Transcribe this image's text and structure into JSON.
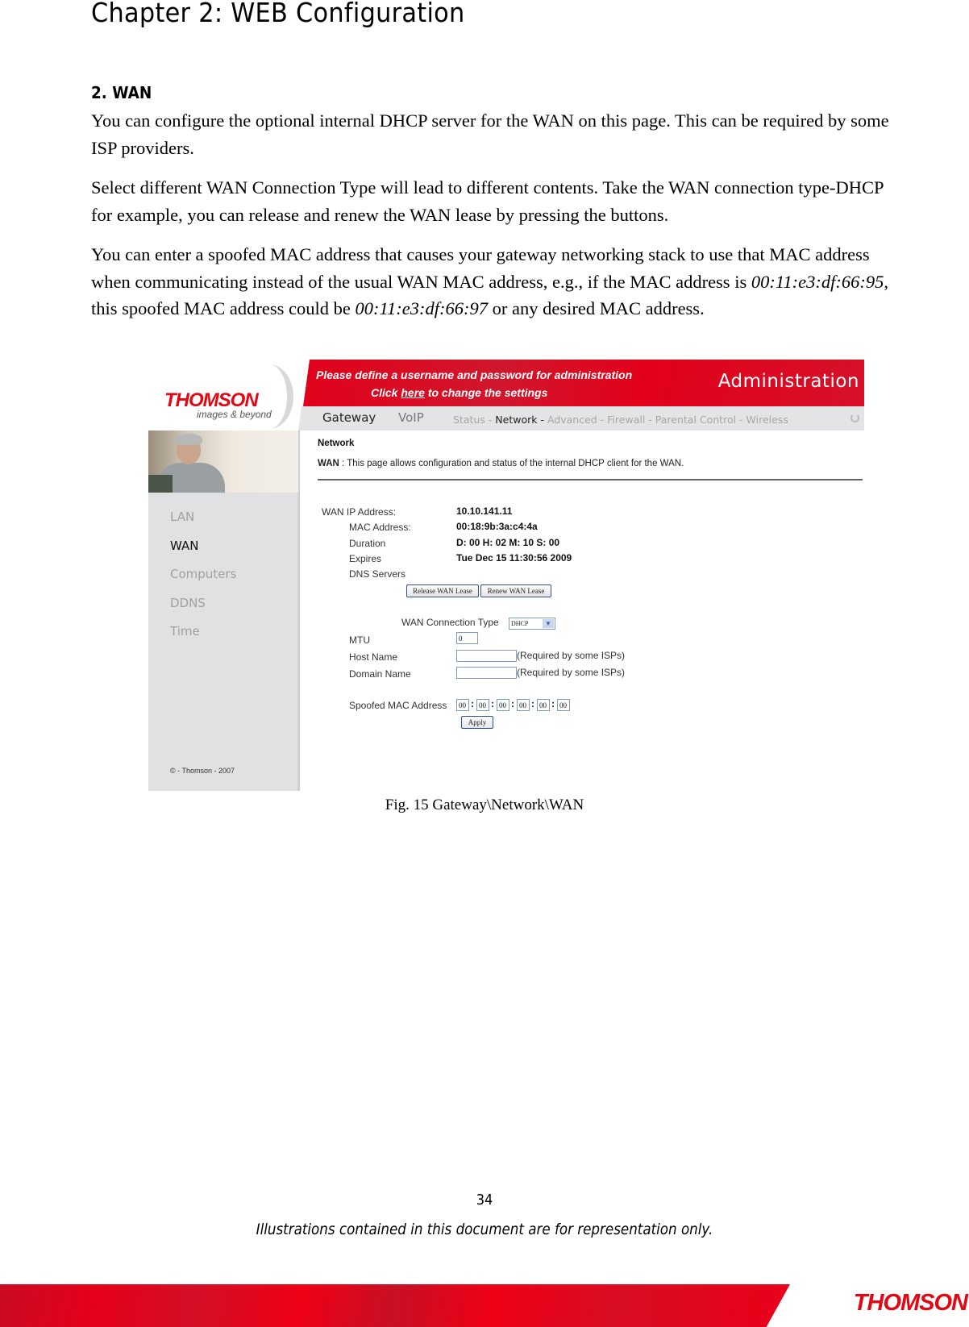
{
  "document": {
    "chapter_title": "Chapter 2: WEB Configuration",
    "section_heading": "2. WAN",
    "paragraphs": {
      "p1": "You can configure the optional internal DHCP server for the WAN on this page. This can be required by some ISP providers.",
      "p2": "Select different WAN Connection Type will lead to different contents. Take the WAN connection type-DHCP for example, you can release and renew the WAN lease by pressing the buttons.",
      "p3_part1": "You can enter a spoofed MAC address that causes your gateway networking stack to use that MAC address when communicating instead of the usual WAN MAC address, e.g., if the MAC address is ",
      "p3_mac1": "00:11:e3:df:66:95",
      "p3_part2": ", this spoofed MAC address could be ",
      "p3_mac2": "00:11:e3:df:66:97",
      "p3_part3": " or any desired MAC address."
    },
    "figure_caption": "Fig. 15 Gateway\\Network\\WAN",
    "page_number": "34",
    "disclaimer": "Illustrations contained in this document are for representation only.",
    "footer_logo": "THOMSON"
  },
  "screenshot": {
    "logo": {
      "brand": "THOMSON",
      "tagline": "images & beyond"
    },
    "banner": {
      "line1": "Please define a username and password for administration",
      "line2_prefix": "Click ",
      "line2_link": "here",
      "line2_suffix": " to change the settings",
      "section": "Administration"
    },
    "nav": {
      "main": [
        {
          "label": "Gateway",
          "active": true
        },
        {
          "label": "VoIP",
          "active": false
        }
      ],
      "sub": [
        {
          "label": "Status - ",
          "active": false
        },
        {
          "label": "Network - ",
          "active": true
        },
        {
          "label": "Advanced - ",
          "active": false
        },
        {
          "label": "Firewall - ",
          "active": false
        },
        {
          "label": "Parental Control - ",
          "active": false
        },
        {
          "label": "Wireless",
          "active": false
        }
      ],
      "refresh_icon": "refresh-icon"
    },
    "sidebar": {
      "items": [
        {
          "label": "LAN",
          "active": false
        },
        {
          "label": "WAN",
          "active": true
        },
        {
          "label": "Computers",
          "active": false
        },
        {
          "label": "DDNS",
          "active": false
        },
        {
          "label": "Time",
          "active": false
        }
      ],
      "copyright": "© - Thomson - 2007"
    },
    "content": {
      "title": "Network",
      "desc_label": "WAN",
      "desc_text": " :  This page allows configuration and status of the internal DHCP client for the WAN.",
      "status": {
        "wan_ip_label": "WAN IP Address:",
        "wan_ip_value": "10.10.141.11",
        "mac_label": "MAC Address:",
        "mac_value": "00:18:9b:3a:c4:4a",
        "duration_label": "Duration",
        "duration_value": "D: 00 H: 02 M: 10 S: 00",
        "expires_label": "Expires",
        "expires_value": "Tue Dec 15 11:30:56 2009",
        "dns_label": "DNS Servers",
        "dns_value": ""
      },
      "buttons": {
        "release": "Release WAN Lease",
        "renew": "Renew WAN Lease",
        "apply": "Apply"
      },
      "form": {
        "connection_type_label": "WAN Connection Type",
        "connection_type_value": "DHCP",
        "mtu_label": "MTU",
        "mtu_value": "0",
        "host_name_label": "Host Name",
        "host_name_value": "",
        "host_name_hint": "(Required by some ISPs)",
        "domain_name_label": "Domain Name",
        "domain_name_value": "",
        "domain_name_hint": "(Required by some ISPs)",
        "spoofed_mac_label": "Spoofed MAC Address",
        "spoofed_mac_octets": [
          "00",
          "00",
          "00",
          "00",
          "00",
          "00"
        ],
        "separator": ":"
      }
    }
  }
}
